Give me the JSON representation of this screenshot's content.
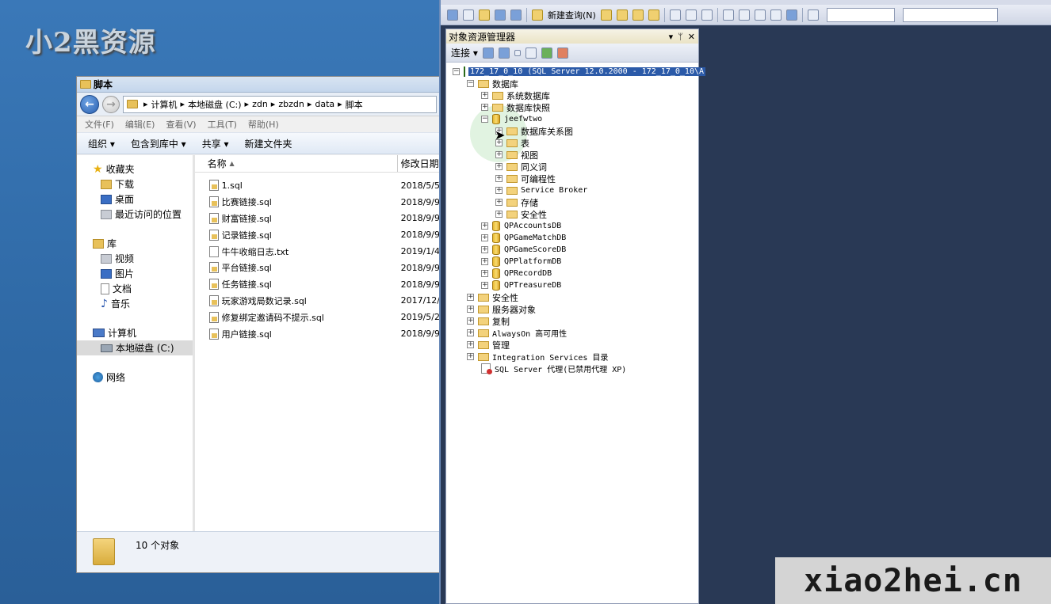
{
  "watermark": "小2黑资源",
  "brand": "xiao2hei.cn",
  "explorer": {
    "title": "脚本",
    "address": [
      "计算机",
      "本地磁盘 (C:)",
      "zdn",
      "zbzdn",
      "data",
      "脚本"
    ],
    "menu": [
      "文件(F)",
      "编辑(E)",
      "查看(V)",
      "工具(T)",
      "帮助(H)"
    ],
    "toolbar": [
      "组织 ▾",
      "包含到库中 ▾",
      "共享 ▾",
      "新建文件夹"
    ],
    "nav": {
      "favorites": "收藏夹",
      "downloads": "下载",
      "desktop": "桌面",
      "recent": "最近访问的位置",
      "libraries": "库",
      "videos": "视频",
      "pictures": "图片",
      "documents": "文档",
      "music": "音乐",
      "computer": "计算机",
      "local_disk": "本地磁盘 (C:)",
      "network": "网络"
    },
    "columns": {
      "name": "名称",
      "date": "修改日期"
    },
    "files": [
      {
        "name": "1.sql",
        "date": "2018/5/5",
        "type": "sql"
      },
      {
        "name": "比赛链接.sql",
        "date": "2018/9/9",
        "type": "sql"
      },
      {
        "name": "财富链接.sql",
        "date": "2018/9/9",
        "type": "sql"
      },
      {
        "name": "记录链接.sql",
        "date": "2018/9/9",
        "type": "sql"
      },
      {
        "name": "牛牛收缩日志.txt",
        "date": "2019/1/4",
        "type": "txt"
      },
      {
        "name": "平台链接.sql",
        "date": "2018/9/9",
        "type": "sql"
      },
      {
        "name": "任务链接.sql",
        "date": "2018/9/9",
        "type": "sql"
      },
      {
        "name": "玩家游戏局数记录.sql",
        "date": "2017/12/",
        "type": "sql"
      },
      {
        "name": "修复绑定邀请码不提示.sql",
        "date": "2019/5/2",
        "type": "sql"
      },
      {
        "name": "用户链接.sql",
        "date": "2018/9/9",
        "type": "sql"
      }
    ],
    "status": "10 个对象"
  },
  "ssms": {
    "new_query": "新建查询(N)",
    "object_explorer": {
      "title": "对象资源管理器",
      "connect": "连接 ▾",
      "server": "172_17_0_10 (SQL Server 12.0.2000 - 172_17_0_10\\A",
      "databases": "数据库",
      "system_dbs": "系统数据库",
      "snapshots": "数据库快照",
      "db_main": "jeefwtwo",
      "db_children": [
        "数据库关系图",
        "表",
        "视图",
        "同义词",
        "可编程性",
        "Service Broker",
        "存储",
        "安全性"
      ],
      "other_dbs": [
        "QPAccountsDB",
        "QPGameMatchDB",
        "QPGameScoreDB",
        "QPPlatformDB",
        "QPRecordDB",
        "QPTreasureDB"
      ],
      "top_nodes": [
        "安全性",
        "服务器对象",
        "复制",
        "AlwaysOn 高可用性",
        "管理",
        "Integration Services 目录"
      ],
      "agent": "SQL Server 代理(已禁用代理 XP)"
    }
  }
}
